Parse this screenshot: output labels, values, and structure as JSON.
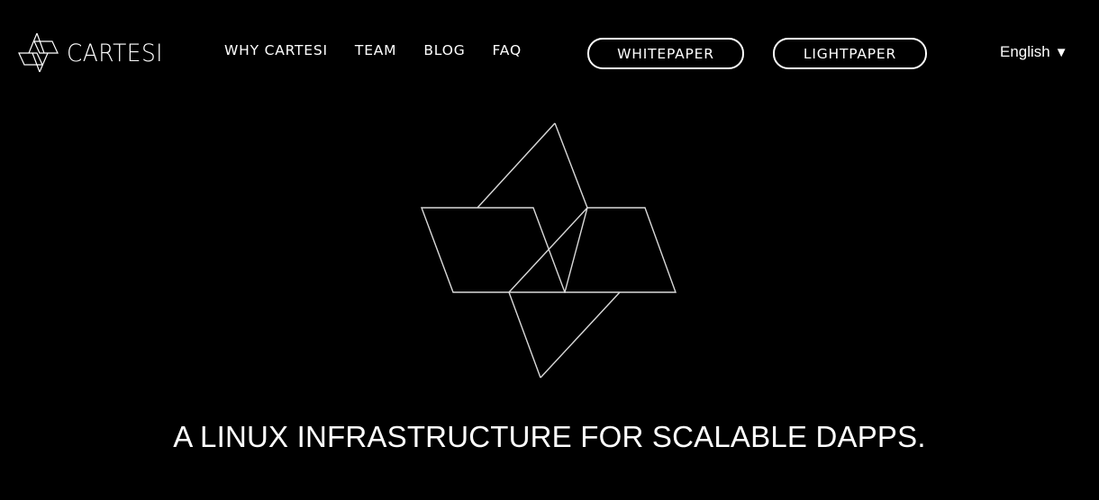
{
  "header": {
    "brand": "CARTESI",
    "brand_icon": "cartesi-logo-icon",
    "nav": [
      {
        "label": "WHY CARTESI"
      },
      {
        "label": "TEAM"
      },
      {
        "label": "BLOG"
      },
      {
        "label": "FAQ"
      }
    ],
    "buttons": {
      "whitepaper": "WHITEPAPER",
      "lightpaper": "LIGHTPAPER"
    },
    "language": {
      "selected": "English",
      "caret": "▼"
    }
  },
  "hero": {
    "emblem_icon": "cartesi-emblem-icon",
    "tagline": "A LINUX INFRASTRUCTURE FOR SCALABLE DAPPS."
  },
  "colors": {
    "background": "#000000",
    "text": "#ffffff",
    "emblem_stroke": "#d9d9d9"
  }
}
